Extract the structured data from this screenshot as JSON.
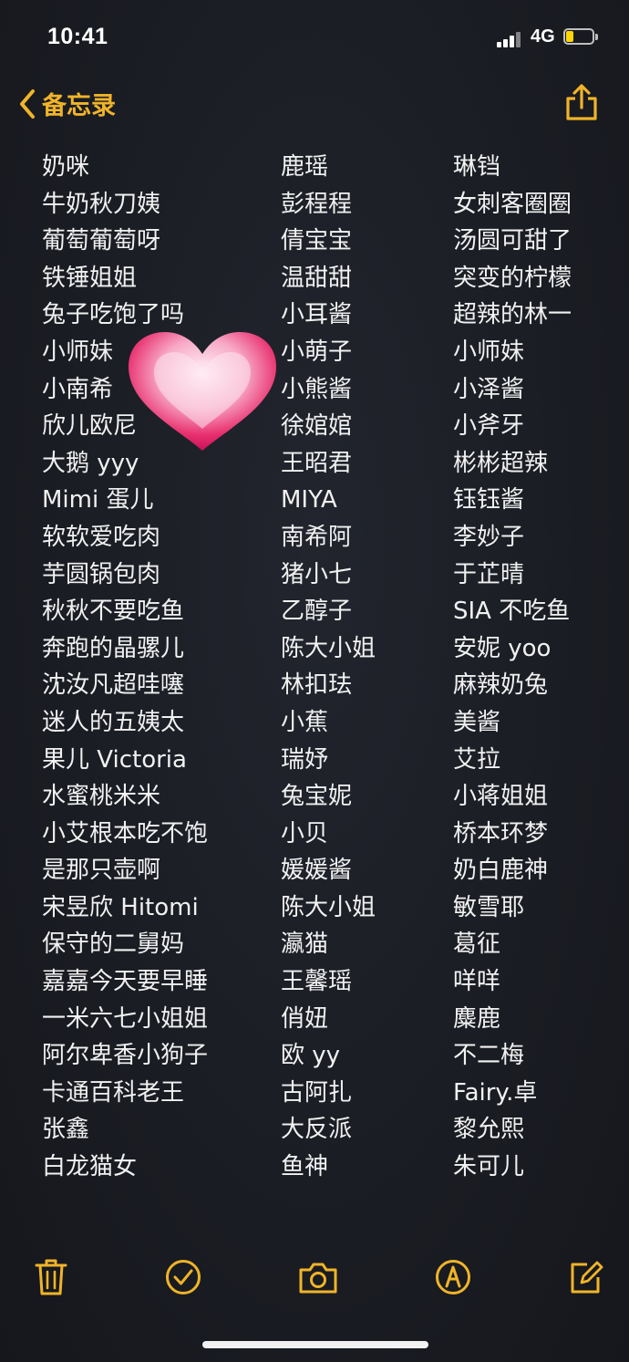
{
  "status": {
    "time": "10:41",
    "network": "4G"
  },
  "nav": {
    "back_label": "备忘录"
  },
  "colors": {
    "accent": "#f0b429",
    "background": "#1b1d24",
    "text": "#f1f1f1",
    "heart": "#e8306e"
  },
  "icons": {
    "back": "chevron-left-icon",
    "share": "share-icon",
    "heart": "heart-icon",
    "trash": "trash-icon",
    "checklist": "checkmark-circle-icon",
    "camera": "camera-icon",
    "markup": "markup-pen-icon",
    "compose": "compose-icon"
  },
  "rows": [
    [
      "奶咪",
      "鹿瑶",
      "琳铛"
    ],
    [
      "牛奶秋刀姨",
      "彭程程",
      "女刺客圈圈"
    ],
    [
      "葡萄葡萄呀",
      "倩宝宝",
      "汤圆可甜了"
    ],
    [
      "铁锤姐姐",
      "温甜甜",
      "突变的柠檬"
    ],
    [
      "兔子吃饱了吗",
      "小耳酱",
      "超辣的林一"
    ],
    [
      "小师妹",
      "小萌子",
      "小师妹"
    ],
    [
      "小南希",
      "小熊酱",
      "小泽酱"
    ],
    [
      "欣儿欧尼",
      "徐婠婠",
      "小斧牙"
    ],
    [
      "大鹅 yyy",
      "王昭君",
      "彬彬超辣"
    ],
    [
      "Mimi 蛋儿",
      "MIYA",
      "钰钰酱"
    ],
    [
      "软软爱吃肉",
      "南希阿",
      "李妙子"
    ],
    [
      "芋圆锅包肉",
      "猪小七",
      "于芷晴"
    ],
    [
      "秋秋不要吃鱼",
      "乙醇子",
      "SIA 不吃鱼"
    ],
    [
      "奔跑的晶骡儿",
      "陈大小姐",
      "安妮 yoo"
    ],
    [
      "沈汝凡超哇噻",
      "林扣珐",
      "麻辣奶兔"
    ],
    [
      "迷人的五姨太",
      "小蕉",
      "美酱"
    ],
    [
      "果儿 Victoria",
      "瑞妤",
      "艾拉"
    ],
    [
      "水蜜桃米米",
      "兔宝妮",
      "小蒋姐姐"
    ],
    [
      "小艾根本吃不饱",
      "小贝",
      "桥本环梦"
    ],
    [
      "是那只壶啊",
      "媛媛酱",
      "奶白鹿神"
    ],
    [
      "宋昱欣 Hitomi",
      "陈大小姐",
      "敏雪耶"
    ],
    [
      "保守的二舅妈",
      "瀛猫",
      "葛征"
    ],
    [
      "嘉嘉今天要早睡",
      "王馨瑶",
      "咩咩"
    ],
    [
      "一米六七小姐姐",
      "俏妞",
      "麋鹿"
    ],
    [
      "阿尔卑香小狗子",
      "欧 yy",
      "不二梅"
    ],
    [
      "卡通百科老王",
      "古阿扎",
      "Fairy.卓"
    ],
    [
      "张鑫",
      "大反派",
      "黎允熙"
    ],
    [
      "白龙猫女",
      "鱼神",
      "朱可儿"
    ]
  ]
}
